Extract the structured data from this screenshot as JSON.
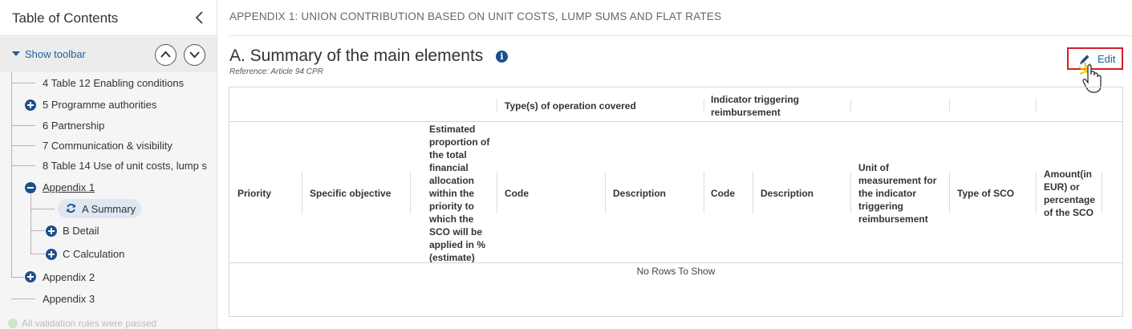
{
  "toc": {
    "title": "Table of Contents",
    "show_toolbar": "Show toolbar",
    "items": [
      {
        "label": "4 Table 12 Enabling conditions"
      },
      {
        "label": "5 Programme authorities"
      },
      {
        "label": "6 Partnership"
      },
      {
        "label": "7 Communication & visibility"
      },
      {
        "label": "8 Table 14 Use of unit costs, lump s"
      },
      {
        "label": "Appendix 1"
      },
      {
        "label": "A Summary"
      },
      {
        "label": "B Detail"
      },
      {
        "label": "C Calculation"
      },
      {
        "label": "Appendix 2"
      },
      {
        "label": "Appendix 3"
      }
    ],
    "validation": "All validation rules were passed"
  },
  "main": {
    "breadcrumb": "APPENDIX 1: UNION CONTRIBUTION BASED ON UNIT COSTS, LUMP SUMS AND FLAT RATES",
    "title": "A. Summary of the main elements",
    "reference": "Reference: Article 94 CPR",
    "edit_label": "Edit"
  },
  "table": {
    "group_headers": [
      "Type(s) of operation covered",
      "Indicator triggering reimbursement"
    ],
    "columns": [
      "Priority",
      "Specific objective",
      "Estimated proportion of the total financial allocation within the priority to which the SCO will be applied in % (estimate)",
      "Code",
      "Description",
      "Code",
      "Description",
      "Unit of measurement for the indicator triggering reimbursement",
      "Type of SCO",
      "Amount(in EUR) or percentage of the SCO"
    ],
    "empty_message": "No Rows To Show"
  },
  "colors": {
    "accent": "#1f5f9e",
    "icon_blue": "#1b4f8a",
    "edit_border": "#d11f2a",
    "selected_bg": "#dfe7f2"
  }
}
